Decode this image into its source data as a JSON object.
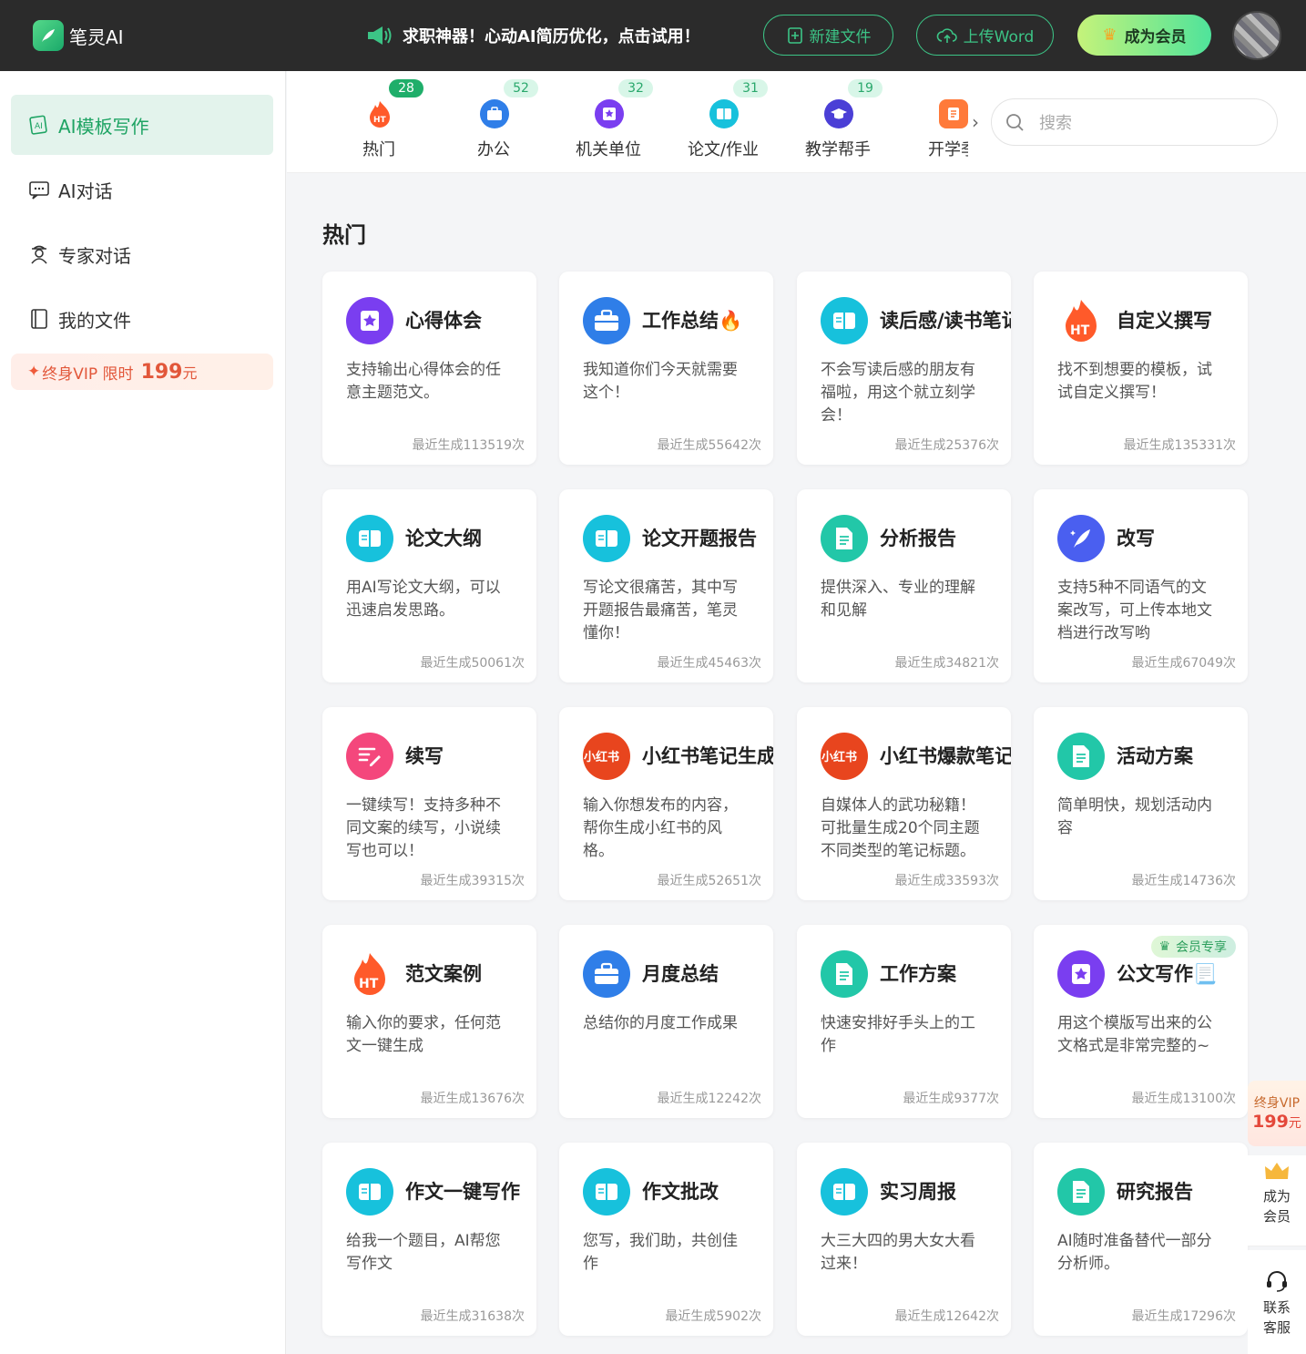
{
  "topbar": {
    "brand": "笔灵AI",
    "promo": "求职神器！心动AI简历优化，点击试用！",
    "new_file": "新建文件",
    "upload_word": "上传Word",
    "become_member": "成为会员"
  },
  "sidebar": {
    "items": [
      {
        "label": "AI模板写作",
        "icon": "ai-template-icon"
      },
      {
        "label": "AI对话",
        "icon": "chat-icon"
      },
      {
        "label": "专家对话",
        "icon": "expert-icon"
      },
      {
        "label": "我的文件",
        "icon": "file-icon"
      }
    ],
    "vip": {
      "text": "终身VIP 限时",
      "price": "199",
      "unit": "元"
    }
  },
  "categories": [
    {
      "label": "热门",
      "count": "28"
    },
    {
      "label": "办公",
      "count": "52"
    },
    {
      "label": "机关单位",
      "count": "32"
    },
    {
      "label": "论文/作业",
      "count": "31"
    },
    {
      "label": "教学帮手",
      "count": "19"
    },
    {
      "label": "开学季",
      "count": ""
    }
  ],
  "search": {
    "placeholder": "搜索"
  },
  "section_title": "热门",
  "cards": [
    {
      "title": "心得体会",
      "desc": "支持输出心得体会的任意主题范文。",
      "count": "最近生成113519次",
      "icon": "star-badge-icon"
    },
    {
      "title": "工作总结🔥",
      "desc": "我知道你们今天就需要这个！",
      "count": "最近生成55642次",
      "icon": "briefcase-icon"
    },
    {
      "title": "读后感/读书笔记",
      "desc": "不会写读后感的朋友有福啦，用这个就立刻学会！",
      "count": "最近生成25376次",
      "icon": "book-icon"
    },
    {
      "title": "自定义撰写",
      "desc": "找不到想要的模板，试试自定义撰写！",
      "count": "最近生成135331次",
      "icon": "hot-flame-icon"
    },
    {
      "title": "论文大纲",
      "desc": "用AI写论文大纲，可以迅速启发思路。",
      "count": "最近生成50061次",
      "icon": "book-icon"
    },
    {
      "title": "论文开题报告",
      "desc": "写论文很痛苦，其中写开题报告最痛苦，笔灵懂你！",
      "count": "最近生成45463次",
      "icon": "book-icon"
    },
    {
      "title": "分析报告",
      "desc": "提供深入、专业的理解和见解",
      "count": "最近生成34821次",
      "icon": "document-icon"
    },
    {
      "title": "改写",
      "desc": "支持5种不同语气的文案改写，可上传本地文档进行改写哟",
      "count": "最近生成67049次",
      "icon": "quill-icon"
    },
    {
      "title": "续写",
      "desc": "一键续写！支持多种不同文案的续写，小说续写也可以！",
      "count": "最近生成39315次",
      "icon": "continue-write-icon"
    },
    {
      "title": "小红书笔记生成",
      "desc": "输入你想发布的内容，帮你生成小红书的风格。",
      "count": "最近生成52651次",
      "icon": "xiaohongshu-icon"
    },
    {
      "title": "小红书爆款笔记",
      "desc": "自媒体人的武功秘籍！可批量生成20个同主题不同类型的笔记标题。",
      "count": "最近生成33593次",
      "icon": "xiaohongshu-icon"
    },
    {
      "title": "活动方案",
      "desc": "简单明快，规划活动内容",
      "count": "最近生成14736次",
      "icon": "document-icon"
    },
    {
      "title": "范文案例",
      "desc": "输入你的要求，任何范文一键生成",
      "count": "最近生成13676次",
      "icon": "hot-flame-icon"
    },
    {
      "title": "月度总结",
      "desc": "总结你的月度工作成果",
      "count": "最近生成12242次",
      "icon": "briefcase-icon"
    },
    {
      "title": "工作方案",
      "desc": "快速安排好手头上的工作",
      "count": "最近生成9377次",
      "icon": "document-icon"
    },
    {
      "title": "公文写作📃",
      "desc": "用这个模版写出来的公文格式是非常完整的~",
      "count": "最近生成13100次",
      "icon": "star-badge-icon",
      "badge": "会员专享"
    },
    {
      "title": "作文一键写作",
      "desc": "给我一个题目，AI帮您写作文",
      "count": "最近生成31638次",
      "icon": "book-icon"
    },
    {
      "title": "作文批改",
      "desc": "您写，我们助，共创佳作",
      "count": "最近生成5902次",
      "icon": "book-icon"
    },
    {
      "title": "实习周报",
      "desc": "大三大四的男大女大看过来！",
      "count": "最近生成12642次",
      "icon": "book-icon"
    },
    {
      "title": "研究报告",
      "desc": "AI随时准备替代一部分分析师。",
      "count": "最近生成17296次",
      "icon": "document-icon"
    }
  ],
  "float": {
    "vip_line1": "终身VIP",
    "vip_price": "199",
    "vip_unit": "元",
    "member": "成为会员",
    "service": "联系客服"
  },
  "colors": {
    "brand_green": "#1fae6a",
    "topbar": "#2b2b2b",
    "vip_red": "#e4483a"
  }
}
